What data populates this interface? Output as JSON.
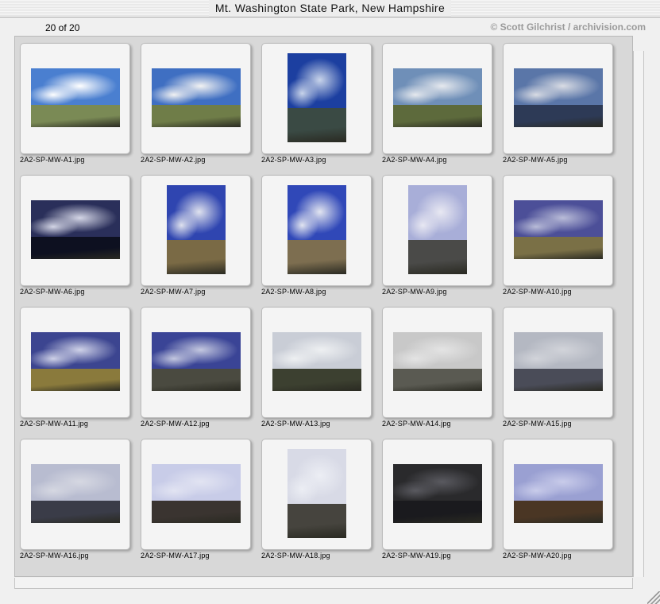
{
  "window": {
    "title": "Mt. Washington State Park, New Hampshire"
  },
  "header": {
    "count": "20 of 20",
    "credit": "© Scott Gilchrist / archivision.com"
  },
  "thumbnails": [
    {
      "filename": "2A2-SP-MW-A1.jpg",
      "orientation": "landscape",
      "sky": "#4a7fd0",
      "cloud": "#ffffff",
      "land": "#7a8a55"
    },
    {
      "filename": "2A2-SP-MW-A2.jpg",
      "orientation": "landscape",
      "sky": "#3f6fc2",
      "cloud": "#f2f2f2",
      "land": "#6f7d48"
    },
    {
      "filename": "2A2-SP-MW-A3.jpg",
      "orientation": "portrait",
      "sky": "#1c3fa0",
      "cloud": "#c8d4ea",
      "land": "#3a4a44"
    },
    {
      "filename": "2A2-SP-MW-A4.jpg",
      "orientation": "landscape",
      "sky": "#6f8fb8",
      "cloud": "#e6e9ee",
      "land": "#5d6a3c"
    },
    {
      "filename": "2A2-SP-MW-A5.jpg",
      "orientation": "landscape",
      "sky": "#5a76a8",
      "cloud": "#d9dce4",
      "land": "#2d3a56"
    },
    {
      "filename": "2A2-SP-MW-A6.jpg",
      "orientation": "landscape",
      "sky": "#2a2f5a",
      "cloud": "#d4d6e6",
      "land": "#0d1020"
    },
    {
      "filename": "2A2-SP-MW-A7.jpg",
      "orientation": "portrait",
      "sky": "#2f45b0",
      "cloud": "#dfe2ee",
      "land": "#7a6a45"
    },
    {
      "filename": "2A2-SP-MW-A8.jpg",
      "orientation": "portrait",
      "sky": "#3048b8",
      "cloud": "#e2e5f0",
      "land": "#7d6e50"
    },
    {
      "filename": "2A2-SP-MW-A9.jpg",
      "orientation": "portrait",
      "sky": "#a8aed8",
      "cloud": "#e8e8f2",
      "land": "#4a4a48"
    },
    {
      "filename": "2A2-SP-MW-A10.jpg",
      "orientation": "landscape",
      "sky": "#4c4f98",
      "cloud": "#b9bcd8",
      "land": "#7a7046"
    },
    {
      "filename": "2A2-SP-MW-A11.jpg",
      "orientation": "landscape",
      "sky": "#3c4590",
      "cloud": "#cfd2e8",
      "land": "#8a7a3c"
    },
    {
      "filename": "2A2-SP-MW-A12.jpg",
      "orientation": "landscape",
      "sky": "#3a4496",
      "cloud": "#c4c8e0",
      "land": "#4a4a40"
    },
    {
      "filename": "2A2-SP-MW-A13.jpg",
      "orientation": "landscape",
      "sky": "#c9cdd6",
      "cloud": "#eef0f2",
      "land": "#3c4030"
    },
    {
      "filename": "2A2-SP-MW-A14.jpg",
      "orientation": "landscape",
      "sky": "#c8c8c8",
      "cloud": "#e4e4e4",
      "land": "#5a5a52"
    },
    {
      "filename": "2A2-SP-MW-A15.jpg",
      "orientation": "landscape",
      "sky": "#b4b8c2",
      "cloud": "#d2d4da",
      "land": "#4a4c58"
    },
    {
      "filename": "2A2-SP-MW-A16.jpg",
      "orientation": "landscape",
      "sky": "#b8bcd0",
      "cloud": "#d6d8e2",
      "land": "#3a3c48"
    },
    {
      "filename": "2A2-SP-MW-A17.jpg",
      "orientation": "landscape",
      "sky": "#c8cce8",
      "cloud": "#e2e4f2",
      "land": "#3a3430"
    },
    {
      "filename": "2A2-SP-MW-A18.jpg",
      "orientation": "portrait",
      "sky": "#d8dae6",
      "cloud": "#eceef4",
      "land": "#46443e"
    },
    {
      "filename": "2A2-SP-MW-A19.jpg",
      "orientation": "landscape",
      "sky": "#2a2a2c",
      "cloud": "#5a5a60",
      "land": "#1a1a1e"
    },
    {
      "filename": "2A2-SP-MW-A20.jpg",
      "orientation": "landscape",
      "sky": "#9aa0d2",
      "cloud": "#c9ccea",
      "land": "#4a3624"
    }
  ]
}
